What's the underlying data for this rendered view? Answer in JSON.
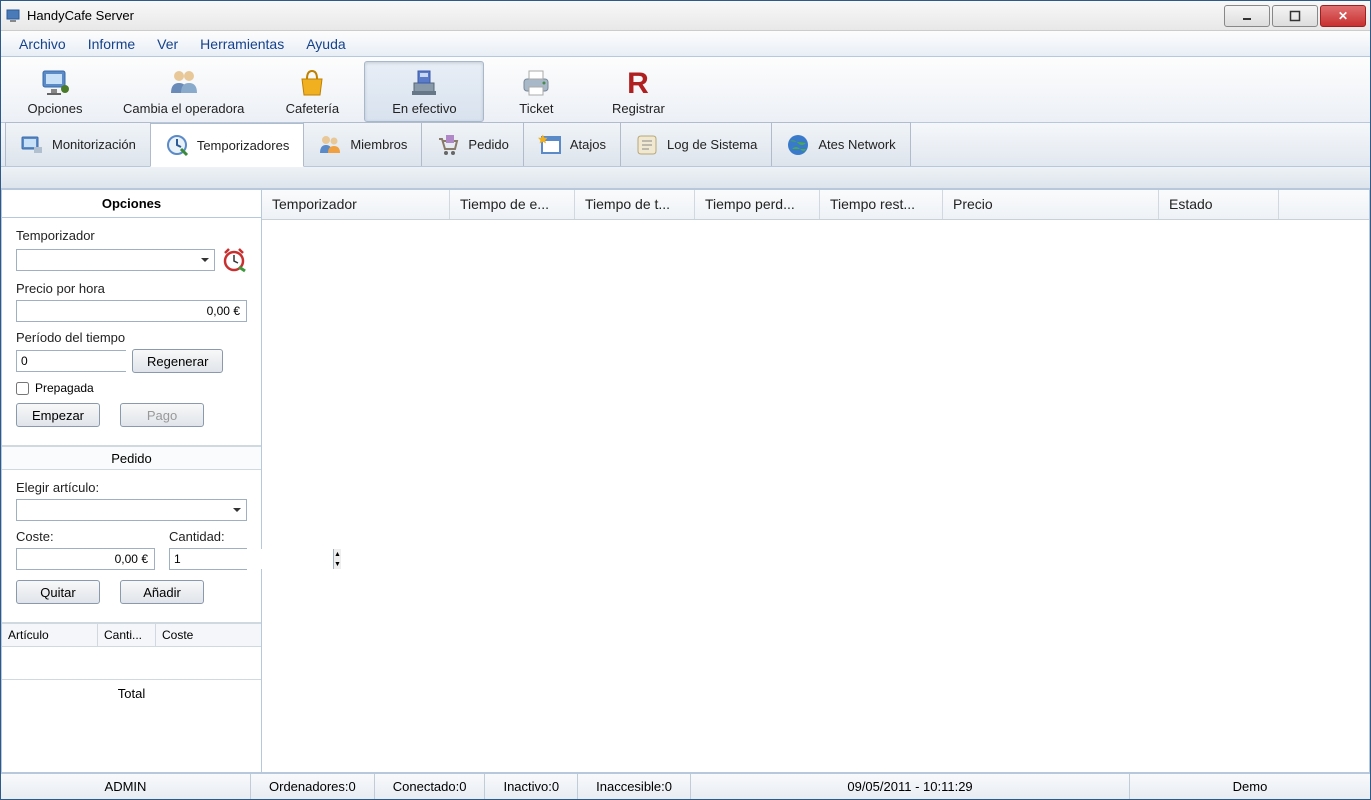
{
  "window": {
    "title": "HandyCafe Server"
  },
  "menu": {
    "items": [
      "Archivo",
      "Informe",
      "Ver",
      "Herramientas",
      "Ayuda"
    ]
  },
  "toolbar": {
    "items": [
      {
        "label": "Opciones",
        "icon": "monitor"
      },
      {
        "label": "Cambia el operadora",
        "icon": "users"
      },
      {
        "label": "Cafetería",
        "icon": "bag"
      },
      {
        "label": "En efectivo",
        "icon": "register",
        "pressed": true
      },
      {
        "label": "Ticket",
        "icon": "printer"
      },
      {
        "label": "Registrar",
        "icon": "letter-r"
      }
    ]
  },
  "tabs": {
    "items": [
      {
        "label": "Monitorización",
        "icon": "monitor-net"
      },
      {
        "label": "Temporizadores",
        "icon": "clock",
        "active": true
      },
      {
        "label": "Miembros",
        "icon": "people"
      },
      {
        "label": "Pedido",
        "icon": "cart"
      },
      {
        "label": "Atajos",
        "icon": "window-star"
      },
      {
        "label": "Log de Sistema",
        "icon": "scroll"
      },
      {
        "label": "Ates Network",
        "icon": "globe"
      }
    ]
  },
  "sidebar": {
    "opciones_header": "Opciones",
    "temporizador_label": "Temporizador",
    "precio_label": "Precio por hora",
    "precio_value": "0,00 €",
    "periodo_label": "Período del tiempo",
    "periodo_value": "0",
    "regenerar": "Regenerar",
    "prepagada": "Prepagada",
    "empezar": "Empezar",
    "pago": "Pago",
    "pedido_header": "Pedido",
    "elegir_label": "Elegir artículo:",
    "coste_label": "Coste:",
    "coste_value": "0,00 €",
    "cantidad_label": "Cantidad:",
    "cantidad_value": "1",
    "quitar": "Quitar",
    "anadir": "Añadir",
    "col_articulo": "Artículo",
    "col_canti": "Canti...",
    "col_coste": "Coste",
    "total": "Total"
  },
  "main_columns": [
    "Temporizador",
    "Tiempo de e...",
    "Tiempo de t...",
    "Tiempo perd...",
    "Tiempo rest...",
    "Precio",
    "Estado"
  ],
  "main_col_widths": [
    188,
    125,
    120,
    125,
    123,
    216,
    120
  ],
  "status": {
    "user": "ADMIN",
    "ordenadores_label": "Ordenadores: ",
    "ordenadores_val": "0",
    "conectado_label": "Conectado: ",
    "conectado_val": "0",
    "inactivo_label": "Inactivo: ",
    "inactivo_val": "0",
    "inaccesible_label": "Inaccesible: ",
    "inaccesible_val": "0",
    "datetime": "09/05/2011 - 10:11:29",
    "mode": "Demo"
  }
}
